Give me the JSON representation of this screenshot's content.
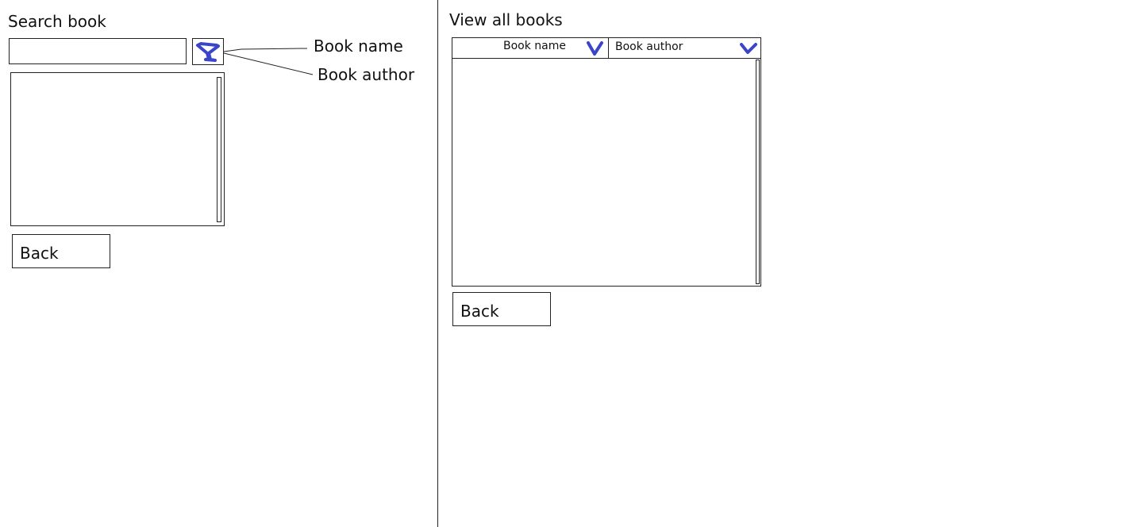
{
  "search_panel": {
    "title": "Search book",
    "search_input_value": "",
    "filter_options": [
      "Book name",
      "Book author"
    ],
    "back_label": "Back"
  },
  "view_panel": {
    "title": "View all books",
    "columns": [
      "Book name",
      "Book author"
    ],
    "back_label": "Back"
  },
  "colors": {
    "accent": "#3b45c8",
    "line": "#222222"
  },
  "icons": {
    "filter": "filter-icon",
    "sort": "chevron-down-icon"
  }
}
